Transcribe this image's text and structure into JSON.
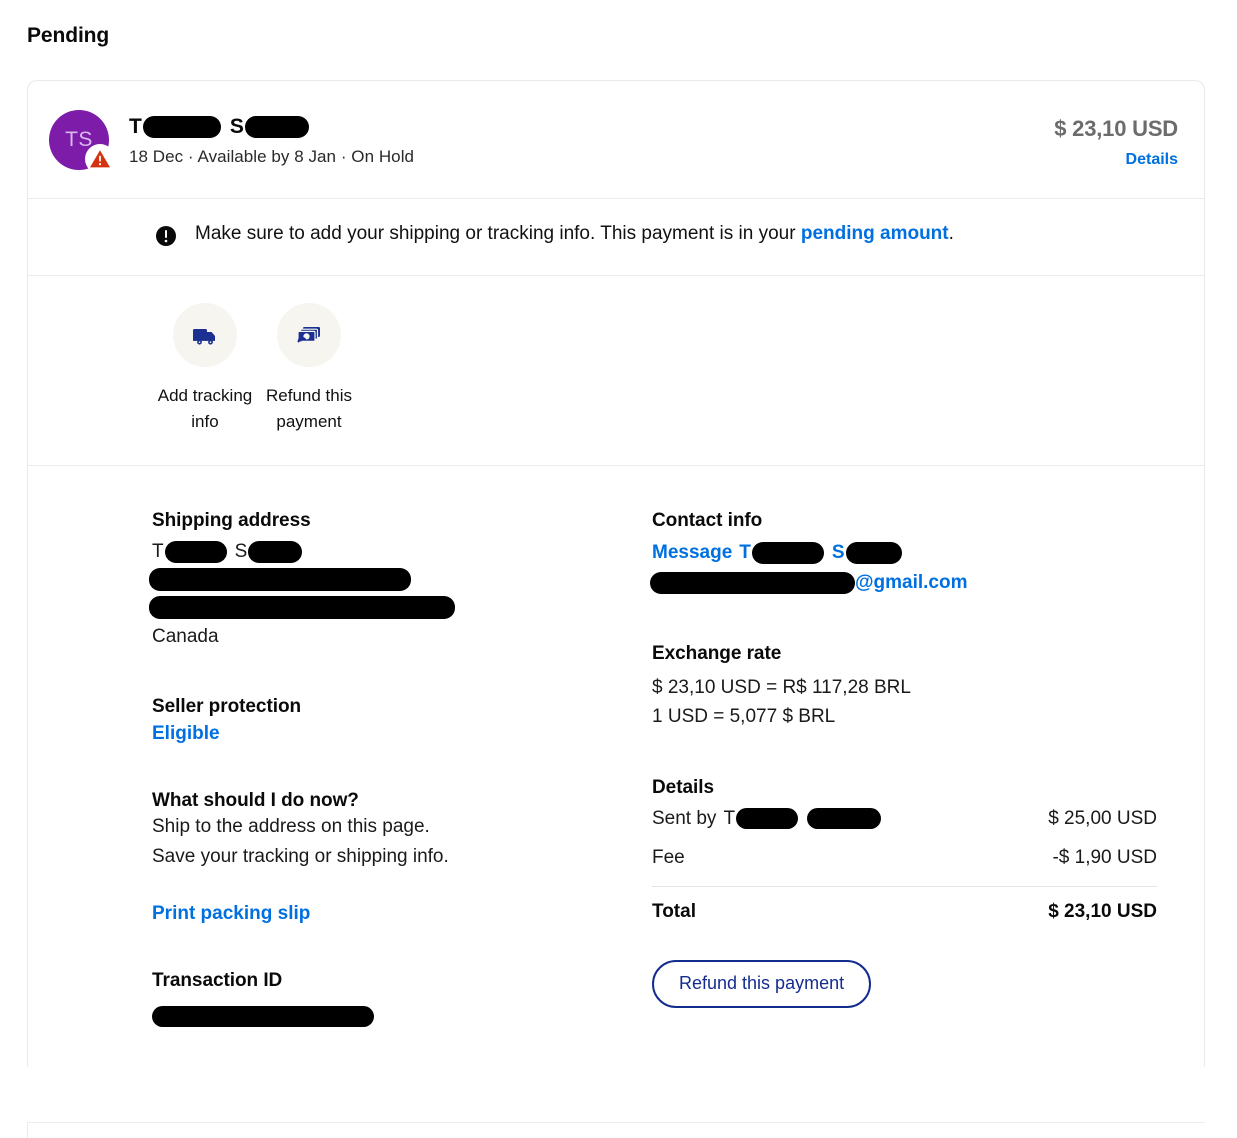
{
  "page": {
    "title": "Pending"
  },
  "header": {
    "avatar_initials": "TS",
    "avatar_color": "#7d1ca8",
    "warning_badge": "warning-triangle-icon",
    "payer_name_prefix_1": "T",
    "payer_name_prefix_2": "S",
    "meta": "18 Dec  ·  Available by 8 Jan  ·  On Hold",
    "amount": "$ 23,10 USD",
    "details_label": "Details"
  },
  "alert": {
    "icon": "exclamation-circle-icon",
    "text_before": "Make sure to add your shipping or tracking info. This payment is in your ",
    "link_text": "pending amount",
    "text_after": "."
  },
  "actions": [
    {
      "icon": "truck-icon",
      "label": "Add tracking info"
    },
    {
      "icon": "refund-money-icon",
      "label": "Refund this payment"
    }
  ],
  "shipping": {
    "title": "Shipping address",
    "name_prefix_1": "T",
    "name_prefix_2": "S",
    "country": "Canada"
  },
  "seller_protection": {
    "title": "Seller protection",
    "status": "Eligible"
  },
  "what_to_do": {
    "title": "What should I do now?",
    "line1": "Ship to the address on this page.",
    "line2": "Save your tracking or shipping info.",
    "print_link": "Print packing slip"
  },
  "transaction": {
    "title": "Transaction ID"
  },
  "contact": {
    "title": "Contact info",
    "message_label": "Message",
    "name_prefix_1": "T",
    "name_prefix_2": "S",
    "email_suffix": "@gmail.com"
  },
  "exchange_rate": {
    "title": "Exchange rate",
    "line1": "$ 23,10 USD = R$ 117,28 BRL",
    "line2": "1 USD = 5,077 $ BRL"
  },
  "details": {
    "title": "Details",
    "sent_by_label": "Sent by",
    "sent_by_amount": "$ 25,00 USD",
    "fee_label": "Fee",
    "fee_amount": "-$ 1,90 USD",
    "total_label": "Total",
    "total_amount": "$ 23,10 USD",
    "refund_button": "Refund this payment"
  },
  "colors": {
    "link_blue": "#0070e0",
    "brand_navy": "#142c8e",
    "amount_gray": "#6c6c6c",
    "avatar_purple": "#7d1ca8",
    "warning_red": "#d5320f"
  }
}
